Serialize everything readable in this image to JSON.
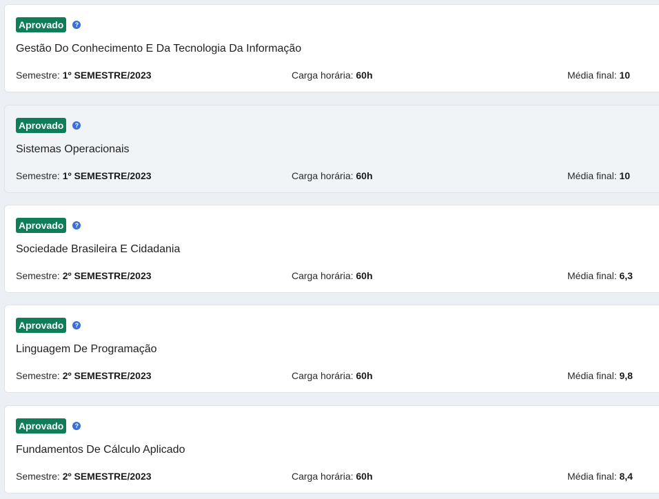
{
  "colors": {
    "badge_green": "#0f7d5a",
    "help_blue": "#3b6fd8",
    "page_bg": "#eceff3"
  },
  "icons": {
    "help": "question-circle-icon",
    "help_glyph": "?"
  },
  "courses": [
    {
      "status": "Aprovado",
      "name": "Gestão Do Conhecimento E Da Tecnologia Da Informação",
      "semester_label": "Semestre:",
      "semester": "1º SEMESTRE/2023",
      "hours_label": "Carga horária:",
      "hours": "60h",
      "grade_label": "Média final:",
      "grade": "10"
    },
    {
      "status": "Aprovado",
      "name": "Sistemas Operacionais",
      "semester_label": "Semestre:",
      "semester": "1º SEMESTRE/2023",
      "hours_label": "Carga horária:",
      "hours": "60h",
      "grade_label": "Média final:",
      "grade": "10"
    },
    {
      "status": "Aprovado",
      "name": "Sociedade Brasileira E Cidadania",
      "semester_label": "Semestre:",
      "semester": "2º SEMESTRE/2023",
      "hours_label": "Carga horária:",
      "hours": "60h",
      "grade_label": "Média final:",
      "grade": "6,3"
    },
    {
      "status": "Aprovado",
      "name": "Linguagem De Programação",
      "semester_label": "Semestre:",
      "semester": "2º SEMESTRE/2023",
      "hours_label": "Carga horária:",
      "hours": "60h",
      "grade_label": "Média final:",
      "grade": "9,8"
    },
    {
      "status": "Aprovado",
      "name": "Fundamentos De Cálculo Aplicado",
      "semester_label": "Semestre:",
      "semester": "2º SEMESTRE/2023",
      "hours_label": "Carga horária:",
      "hours": "60h",
      "grade_label": "Média final:",
      "grade": "8,4"
    }
  ]
}
